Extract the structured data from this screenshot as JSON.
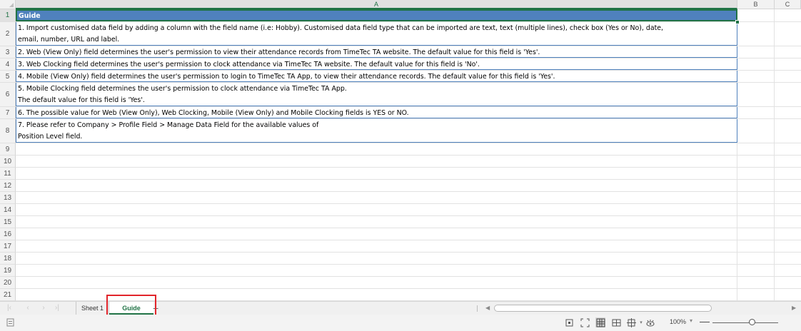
{
  "columns": {
    "a": "A",
    "b": "B",
    "c": "C"
  },
  "rows": [
    {
      "num": "1",
      "text": "Guide"
    },
    {
      "num": "2",
      "text": "1. Import customised data field by adding a column with the field name (i.e: Hobby). Customised data field type that can be imported are text, text (multiple lines), check box (Yes or No), date,\nemail, number, URL and label."
    },
    {
      "num": "3",
      "text": "2. Web (View Only) field determines the user's permission to view their attendance records from TimeTec TA website. The default value for this field is 'Yes'."
    },
    {
      "num": "4",
      "text": "3. Web Clocking field determines the user's permission to clock attendance via TimeTec TA website. The default value for this field is 'No'."
    },
    {
      "num": "5",
      "text": "4. Mobile (View Only) field determines the user's permission to login to TimeTec TA App, to view their attendance records. The default value for this field is 'Yes'."
    },
    {
      "num": "6",
      "text": "5. Mobile Clocking field determines the user's permission to clock attendance via TimeTec TA App.\nThe default value for this field is 'Yes'."
    },
    {
      "num": "7",
      "text": "6. The possible value for Web (View Only), Web Clocking, Mobile (View Only) and Mobile Clocking fields is YES or NO."
    },
    {
      "num": "8",
      "text": "7. Please refer to Company > Profile Field > Manage Data Field for the available values of\nPosition Level field."
    },
    {
      "num": "9",
      "text": ""
    },
    {
      "num": "10",
      "text": ""
    },
    {
      "num": "11",
      "text": ""
    },
    {
      "num": "12",
      "text": ""
    },
    {
      "num": "13",
      "text": ""
    },
    {
      "num": "14",
      "text": ""
    },
    {
      "num": "15",
      "text": ""
    },
    {
      "num": "16",
      "text": ""
    },
    {
      "num": "17",
      "text": ""
    },
    {
      "num": "18",
      "text": ""
    },
    {
      "num": "19",
      "text": ""
    },
    {
      "num": "20",
      "text": ""
    },
    {
      "num": "21",
      "text": ""
    }
  ],
  "sheets": {
    "sheet1": "Sheet 1",
    "guide": "Guide",
    "add": "+"
  },
  "status": {
    "zoom": "100%"
  },
  "colors": {
    "header_fill": "#4f81bd",
    "accent": "#217346",
    "highlight": "#e1252b"
  }
}
